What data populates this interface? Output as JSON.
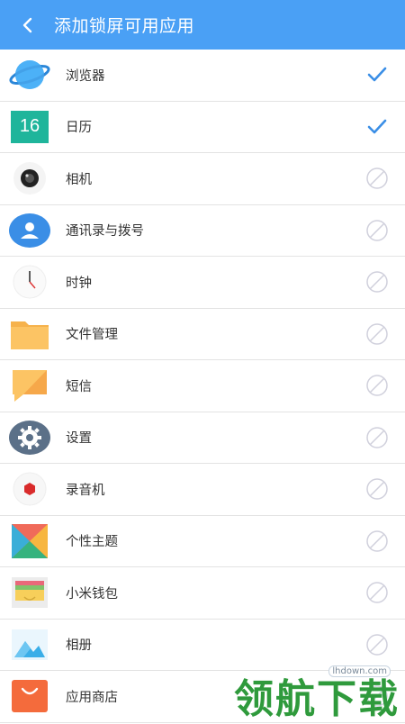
{
  "header": {
    "title": "添加锁屏可用应用"
  },
  "apps": [
    {
      "label": "浏览器",
      "icon": "browser-icon",
      "status": "checked"
    },
    {
      "label": "日历",
      "icon": "calendar-icon",
      "status": "checked",
      "icon_text": "16"
    },
    {
      "label": "相机",
      "icon": "camera-icon",
      "status": "disabled"
    },
    {
      "label": "通讯录与拨号",
      "icon": "contacts-icon",
      "status": "disabled"
    },
    {
      "label": "时钟",
      "icon": "clock-icon",
      "status": "disabled"
    },
    {
      "label": "文件管理",
      "icon": "folder-icon",
      "status": "disabled"
    },
    {
      "label": "短信",
      "icon": "message-icon",
      "status": "disabled"
    },
    {
      "label": "设置",
      "icon": "settings-icon",
      "status": "disabled"
    },
    {
      "label": "录音机",
      "icon": "recorder-icon",
      "status": "disabled"
    },
    {
      "label": "个性主题",
      "icon": "themes-icon",
      "status": "disabled"
    },
    {
      "label": "小米钱包",
      "icon": "wallet-icon",
      "status": "disabled"
    },
    {
      "label": "相册",
      "icon": "gallery-icon",
      "status": "disabled"
    },
    {
      "label": "应用商店",
      "icon": "app-store-icon",
      "status": "disabled"
    }
  ],
  "watermark": {
    "site": "lhdown.com",
    "brand": "领航下载"
  },
  "colors": {
    "header": "#4aa0f5",
    "check": "#3a8ee6",
    "disabled": "#d0d0dc"
  }
}
